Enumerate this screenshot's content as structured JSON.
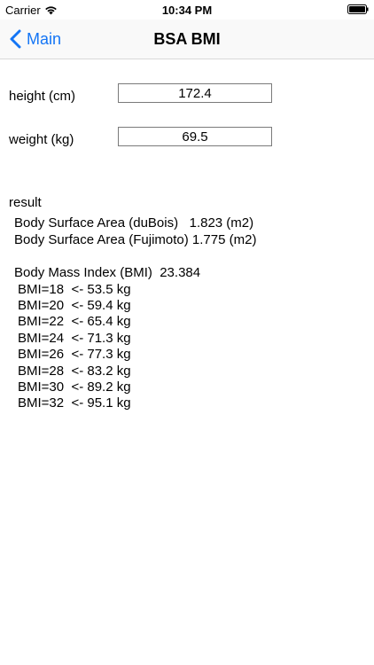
{
  "status": {
    "carrier": "Carrier",
    "time": "10:34 PM"
  },
  "nav": {
    "back_label": "Main",
    "title": "BSA BMI"
  },
  "inputs": {
    "height_label": "height (cm)",
    "height_value": "172.4",
    "weight_label": "weight (kg)",
    "weight_value": "69.5"
  },
  "result": {
    "heading": "result",
    "bsa_dubois": "Body Surface Area (duBois)   1.823 (m2)",
    "bsa_fujimoto": "Body Surface Area (Fujimoto) 1.775 (m2)",
    "bmi": "Body Mass Index (BMI)  23.384",
    "bmi_table": [
      "BMI=18  <- 53.5 kg",
      "BMI=20  <- 59.4 kg",
      "BMI=22  <- 65.4 kg",
      "BMI=24  <- 71.3 kg",
      "BMI=26  <- 77.3 kg",
      "BMI=28  <- 83.2 kg",
      "BMI=30  <- 89.2 kg",
      "BMI=32  <- 95.1 kg"
    ]
  },
  "colors": {
    "accent": "#1475f5"
  }
}
